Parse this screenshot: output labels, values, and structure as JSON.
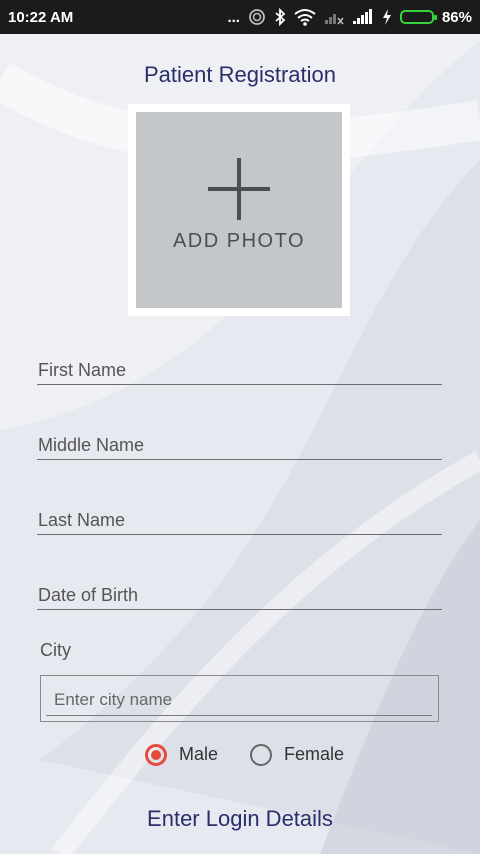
{
  "status_bar": {
    "time": "10:22 AM",
    "dots": "...",
    "battery_percent": "86%",
    "battery_level": 0.86,
    "icons": [
      "more-dots-icon",
      "hotspot-icon",
      "bluetooth-icon",
      "wifi-icon",
      "signal-x-icon",
      "signal-icon",
      "charging-icon",
      "battery-icon"
    ]
  },
  "page": {
    "title": "Patient Registration",
    "add_photo_label": "ADD PHOTO"
  },
  "form": {
    "first_name_placeholder": "First Name",
    "middle_name_placeholder": "Middle Name",
    "last_name_placeholder": "Last Name",
    "dob_placeholder": "Date of Birth",
    "city_label": "City",
    "city_placeholder": "Enter city name",
    "gender": {
      "options": [
        "Male",
        "Female"
      ],
      "selected": "Male"
    }
  },
  "section": {
    "login_title": "Enter Login Details"
  },
  "colors": {
    "accent": "#2a2f6b",
    "radio_selected": "#e64a3a",
    "battery": "#37d13a"
  }
}
